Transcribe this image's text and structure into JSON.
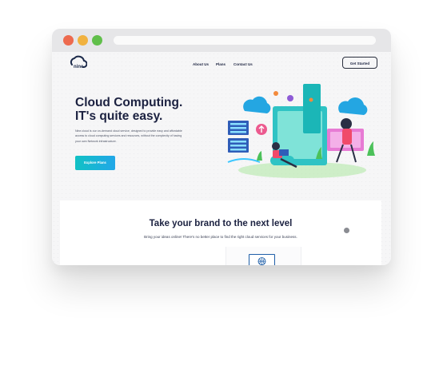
{
  "brand": {
    "logo_text": "nine"
  },
  "nav": {
    "about": "About Us",
    "plans": "Plans",
    "contact": "Contact Us",
    "cta": "Get Started"
  },
  "hero": {
    "title_line1": "Cloud Computing.",
    "title_line2": "IT's quite easy.",
    "description_line1": "Nine.cloud is our on-demand cloud service, designed to provide easy and affordable",
    "description_line2": "access to cloud computing services and resources, without the complexity of having",
    "description_line3": "your own Network infrastructure.",
    "button": "Explore Plans"
  },
  "section": {
    "title": "Take your brand to the next level",
    "subtitle": "Bring your ideas online! There's no better place to find the right cloud services for your business."
  },
  "colors": {
    "accent_start": "#11c1c4",
    "accent_end": "#22a7e8",
    "heading": "#1b2140",
    "window_red": "#ed6a4e",
    "window_yellow": "#f1b23f",
    "window_green": "#60bf4a"
  },
  "icons": [
    "cloud-logo-icon",
    "globe-monitor-icon"
  ]
}
